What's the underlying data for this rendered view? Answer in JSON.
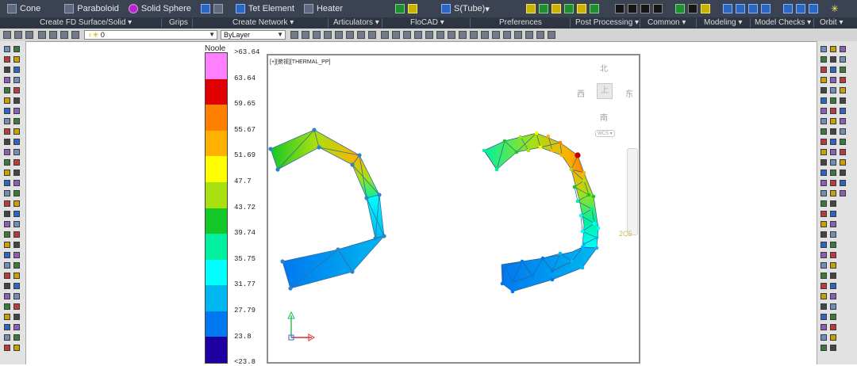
{
  "ribbon": {
    "row1": [
      {
        "label": "Cone",
        "icon": "cone-icon",
        "color": "#5d6a80"
      },
      {
        "label": "Paraboloid",
        "icon": "paraboloid-icon",
        "color": "#5d6a80"
      },
      {
        "label": "Solid Sphere",
        "icon": "sphere-icon",
        "color": "#b427c8"
      },
      {
        "label": "",
        "icon": "grid-icon",
        "color": "#5d6a80"
      },
      {
        "label": "Tet Element",
        "icon": "tet-element-icon",
        "color": "#5d6a80"
      },
      {
        "label": "Heater",
        "icon": "heater-icon",
        "color": "#5d6a80"
      },
      {
        "label": "",
        "icon": "articulator-icon",
        "color": "#1f8f2f"
      },
      {
        "label": "S(Tube)",
        "icon": "tube-icon",
        "color": "#2a66c2"
      }
    ],
    "panels": [
      {
        "label": "Create FD Surface/Solid ▾"
      },
      {
        "label": "Grips"
      },
      {
        "label": "Create Network ▾"
      },
      {
        "label": "Articulators ▾"
      },
      {
        "label": "FloCAD ▾"
      },
      {
        "label": "Preferences"
      },
      {
        "label": "Post Processing ▾"
      },
      {
        "label": "Common ▾"
      },
      {
        "label": "Modeling ▾"
      },
      {
        "label": "Model Checks ▾"
      },
      {
        "label": "Orbit ▾"
      }
    ]
  },
  "propbar": {
    "layer_value": "0",
    "linetype_value": "ByLayer"
  },
  "legend": {
    "title": "Noole",
    "labels": [
      ">63.64",
      "63.64",
      "59.65",
      "55.67",
      "51.69",
      "47.7",
      "43.72",
      "39.74",
      "35.75",
      "31.77",
      "27.79",
      "23.8",
      "<23.8"
    ],
    "colors": [
      "#ff80ff",
      "#e00000",
      "#ff7f00",
      "#ffb000",
      "#ffff00",
      "#a8e010",
      "#14c828",
      "#00f0a0",
      "#00ffff",
      "#00b8f0",
      "#0078f0",
      "#1e00a0"
    ]
  },
  "viewport": {
    "label": "[+][俯视][THERMAL_PP]",
    "viewcube": {
      "north": "北",
      "south": "南",
      "west": "西",
      "east": "东",
      "face": "上",
      "wcs": "WCS ▾"
    },
    "dimension_text": "2C5"
  },
  "colors": {
    "ribbon_bg": "#3b4353",
    "ribbon_row2": "#2d3442",
    "toolbar_bg": "#e2e2e2"
  }
}
